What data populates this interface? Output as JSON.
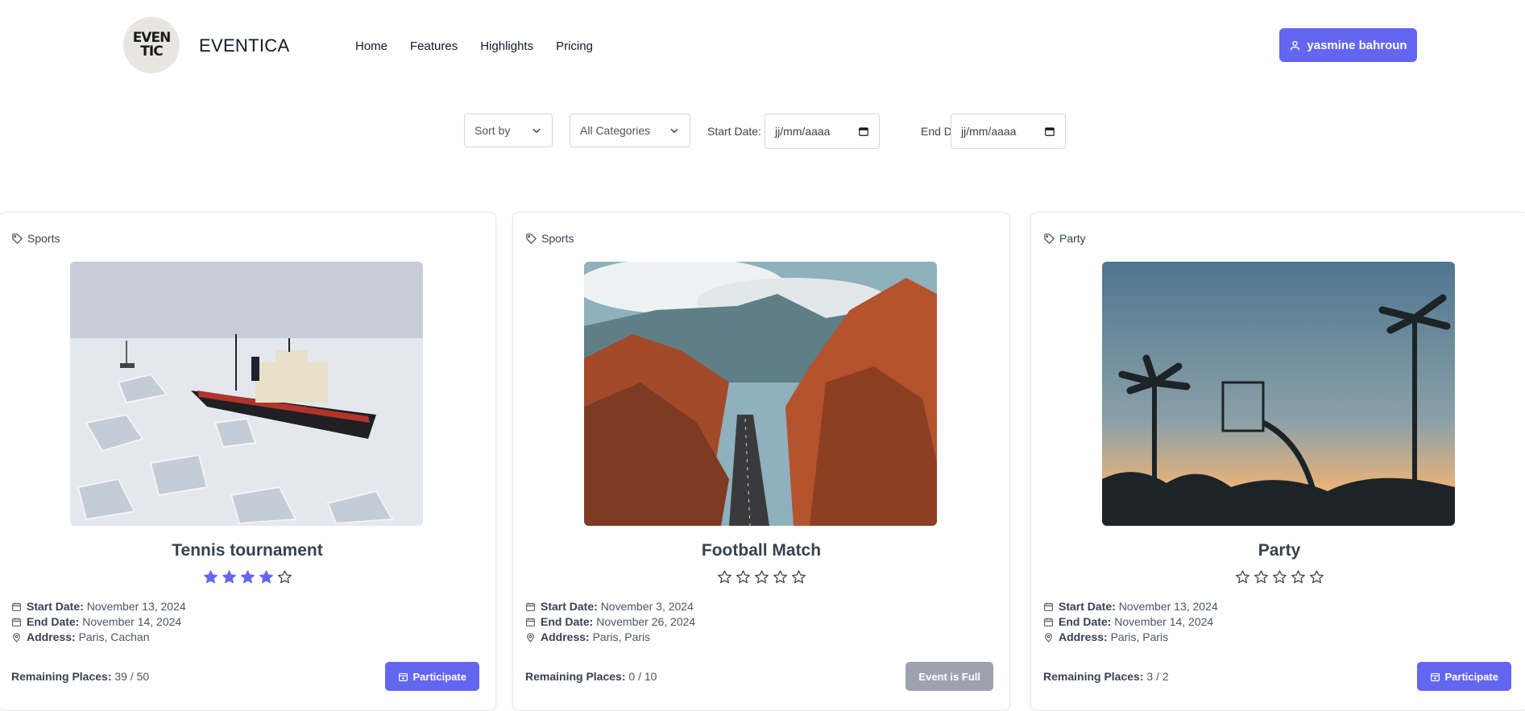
{
  "header": {
    "logo_text_line1": "EVEN",
    "logo_text_line2": "TIC",
    "brand": "EVENTICA",
    "nav": [
      "Home",
      "Features",
      "Highlights",
      "Pricing"
    ],
    "user_button": "yasmine bahroun",
    "user_icon": "user-icon"
  },
  "filters": {
    "sort_by": "Sort by",
    "category": "All Categories",
    "start_label": "Start Date:",
    "start_value": "jj/mm/aaaa",
    "end_label": "End Date:",
    "end_value": "jj/mm/aaaa"
  },
  "labels": {
    "start": "Start Date:",
    "end": "End Date:",
    "address": "Address:",
    "remaining": "Remaining Places:"
  },
  "events": [
    {
      "category": "Sports",
      "title": "Tennis tournament",
      "rating": 4,
      "start": "November 13, 2024",
      "end": "November 14, 2024",
      "address": "Paris, Cachan",
      "remaining": "39 / 50",
      "button": "Participate",
      "button_state": "active",
      "image": "icebreaker ship in sea ice"
    },
    {
      "category": "Sports",
      "title": "Football Match",
      "rating": 0,
      "start": "November 3, 2024",
      "end": "November 26, 2024",
      "address": "Paris, Paris",
      "remaining": "0 / 10",
      "button": "Event is Full",
      "button_state": "disabled",
      "image": "desert road through red rocks"
    },
    {
      "category": "Party",
      "title": "Party",
      "rating": 0,
      "start": "November 13, 2024",
      "end": "November 14, 2024",
      "address": "Paris, Paris",
      "remaining": "3 / 2",
      "button": "Participate",
      "button_state": "active",
      "image": "basketball hoop and palm trees at sunset"
    }
  ],
  "colors": {
    "accent": "#6366f1",
    "disabled": "#9ca3af",
    "star": "#6366f1"
  }
}
